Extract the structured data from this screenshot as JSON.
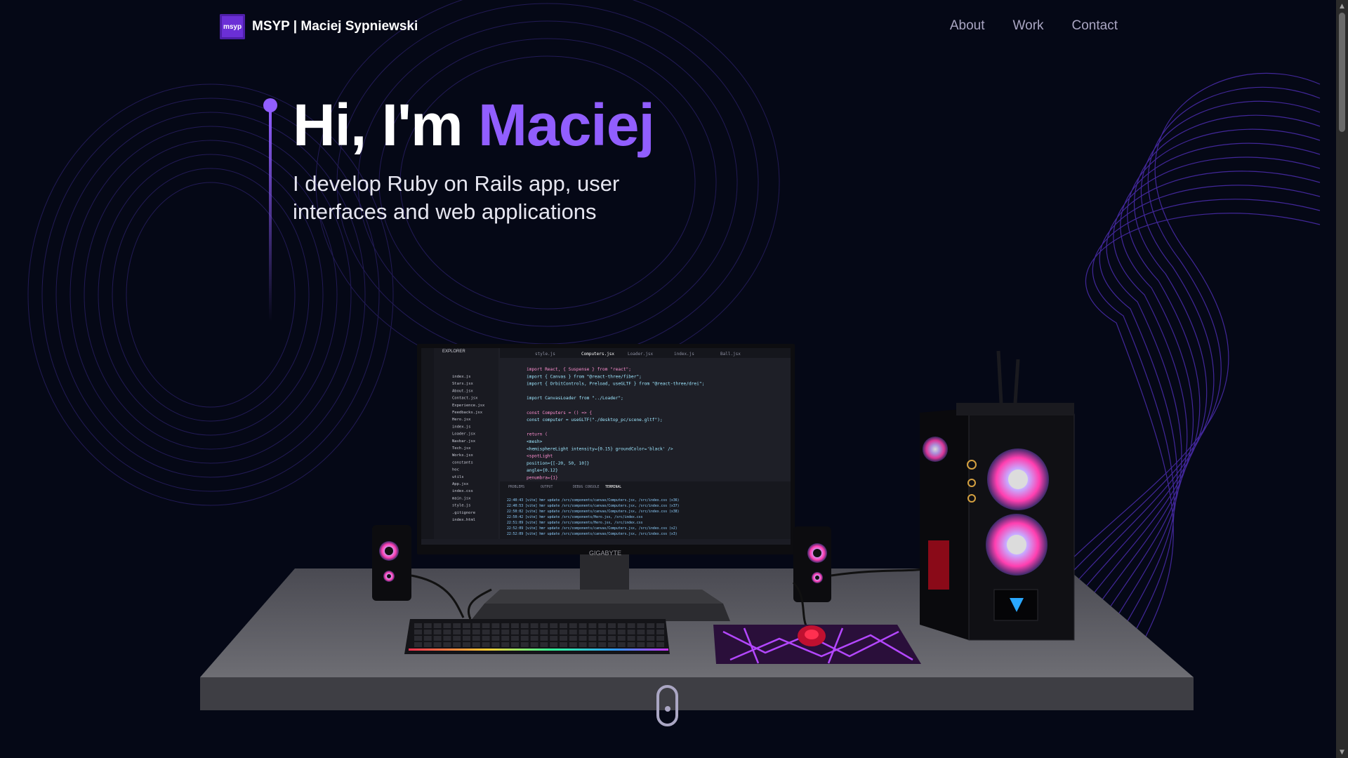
{
  "nav": {
    "logo_text": "msyp",
    "brand": "MSYP  | Maciej Sypniewski",
    "links": [
      "About",
      "Work",
      "Contact"
    ]
  },
  "hero": {
    "greeting": "Hi, I'm ",
    "name": "Maciej",
    "subtitle": "I develop Ruby on Rails app, user interfaces and web applications"
  },
  "scene": {
    "monitor_brand": "GIGABYTE",
    "editor_tabs": [
      "style.js",
      "Computers.jsx",
      "Loader.jsx",
      "index.js",
      "Ball.jsx"
    ],
    "panel_tabs": [
      "PROBLEMS",
      "OUTPUT",
      "DEBUG CONSOLE",
      "TERMINAL"
    ],
    "explorer_title": "EXPLORER",
    "explorer_files": [
      "index.js",
      "Stars.jsx",
      "About.jsx",
      "Contact.jsx",
      "Experience.jsx",
      "Feedbacks.jsx",
      "Hero.jsx",
      "index.js",
      "Loader.jsx",
      "Navbar.jsx",
      "Tech.jsx",
      "Works.jsx",
      "constants",
      "hoc",
      "utils",
      "App.jsx",
      "index.css",
      "main.jsx",
      "style.js",
      ".gitignore",
      "index.html"
    ],
    "code_lines": [
      "import React, { Suspense } from \"react\";",
      "import { Canvas } from \"@react-three/fiber\";",
      "import { OrbitControls, Preload, useGLTF } from \"@react-three/drei\";",
      "",
      "import CanvasLoader from \"../Loader\";",
      "",
      "const Computers = () => {",
      "  const computer = useGLTF(\"./desktop_pc/scene.gltf\");",
      "",
      "  return (",
      "    <mesh>",
      "      <hemisphereLight intensity={0.15} groundColor='black' />",
      "      <spotLight",
      "        position={[-20, 50, 10]}",
      "        angle={0.12}",
      "        penumbra={1}"
    ],
    "terminal_lines": [
      "22:40:43 [vite] hmr update /src/components/canvas/Computers.jsx, /src/index.css (x36)",
      "22:40:53 [vite] hmr update /src/components/canvas/Computers.jsx, /src/index.css (x37)",
      "22:50:02 [vite] hmr update /src/components/canvas/Computers.jsx, /src/index.css (x38)",
      "22:50:42 [vite] hmr update /src/components/Hero.jsx, /src/index.css",
      "22:51:09 [vite] hmr update /src/components/Hero.jsx, /src/index.css",
      "22:52:09 [vite] hmr update /src/components/canvas/Computers.jsx, /src/index.css (x2)",
      "22:52:09 [vite] hmr update /src/components/canvas/Computers.jsx, /src/index.css (x3)"
    ]
  },
  "colors": {
    "background": "#050816",
    "accent": "#915eff",
    "nav_text": "#aaa6c3"
  }
}
